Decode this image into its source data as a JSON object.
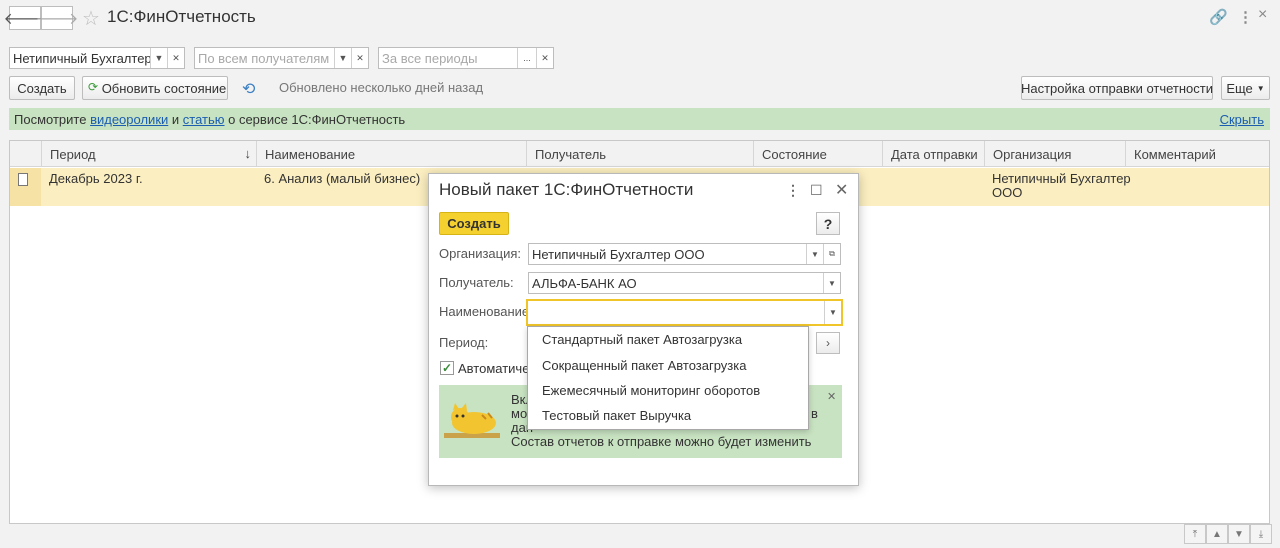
{
  "app": {
    "title": "1С:ФинОтчетность"
  },
  "filters": {
    "organization": "Нетипичный Бухгалтер ОО",
    "recipient_placeholder": "По всем получателям",
    "period_placeholder": "За все периоды"
  },
  "toolbar": {
    "create_label": "Создать",
    "refresh_label": "Обновить состояние",
    "status_text": "Обновлено несколько дней назад",
    "settings_label": "Настройка отправки отчетности",
    "more_label": "Еще"
  },
  "info_strip": {
    "prefix": "Посмотрите ",
    "link1": "видеоролики",
    "and": " и ",
    "link2": "статью",
    "suffix": " о сервисе 1С:ФинОтчетность",
    "hide_label": "Скрыть"
  },
  "table": {
    "columns": [
      "Период",
      "Наименование",
      "Получатель",
      "Состояние",
      "Дата отправки",
      "Организация",
      "Комментарий"
    ],
    "sort_indicator": "↓",
    "rows": [
      {
        "period": "Декабрь 2023 г.",
        "name": "6. Анализ (малый бизнес)",
        "organization_line1": "Нетипичный Бухгалтер",
        "organization_line2": "ООО"
      }
    ]
  },
  "dialog": {
    "title": "Новый пакет 1С:ФинОтчетности",
    "create_label": "Создать",
    "help_label": "?",
    "org_label": "Организация:",
    "org_value": "Нетипичный Бухгалтер ООО",
    "recipient_label": "Получатель:",
    "recipient_value": "АЛЬФА-БАНК АО",
    "name_label": "Наименование:",
    "name_value": "",
    "period_label": "Период:",
    "auto_label": "Автоматичес",
    "green_line1": "Вкл",
    "green_line2": "мож",
    "green_line3": "дан",
    "green_line4": "Состав отчетов к отправке можно будет изменить",
    "green_right": "в",
    "dropdown_items": [
      "Стандартный пакет Автозагрузка",
      "Сокращенный пакет Автозагрузка",
      "Ежемесячный мониторинг оборотов",
      "Тестовый пакет Выручка"
    ]
  }
}
